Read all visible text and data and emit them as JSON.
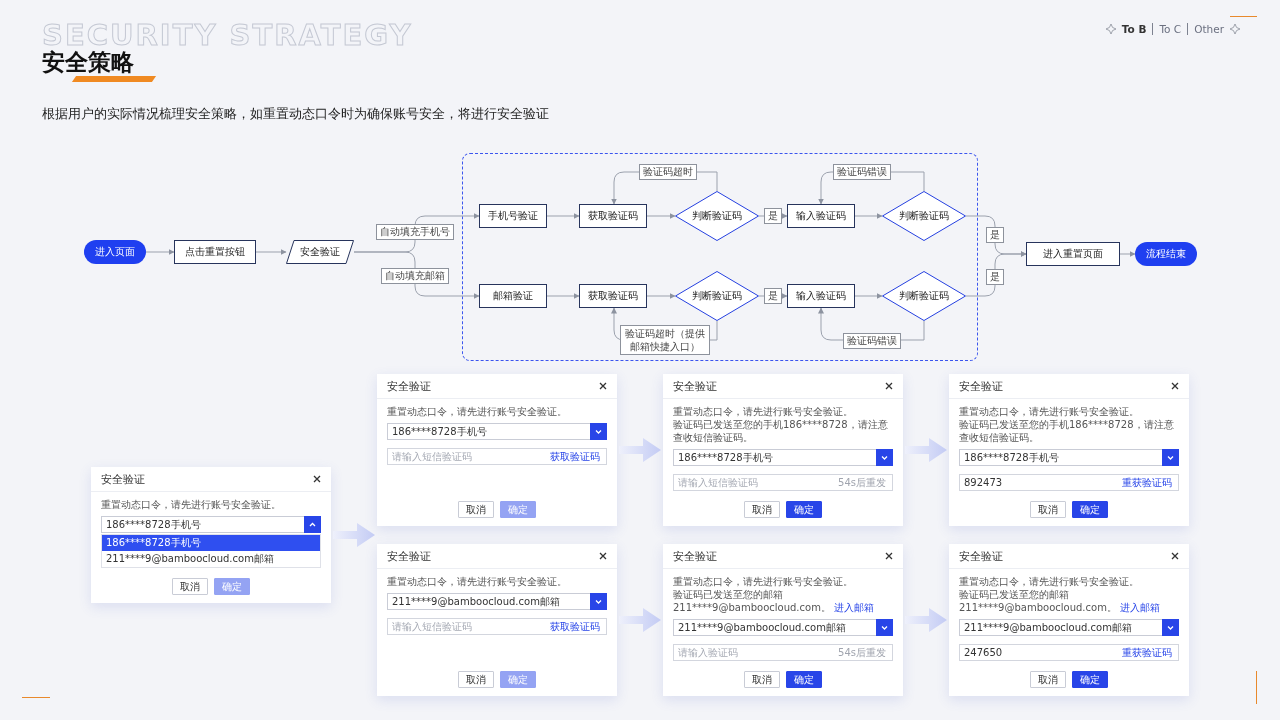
{
  "header": {
    "backdrop_text": "SECURITY STRATEGY",
    "title": "安全策略",
    "description": "根据用户的实际情况梳理安全策略，如重置动态口令时为确保账号安全，将进行安全验证"
  },
  "nav": {
    "tabs": [
      {
        "label": "To B",
        "selected": true
      },
      {
        "label": "To C",
        "selected": false
      },
      {
        "label": "Other",
        "selected": false
      }
    ]
  },
  "flowchart": {
    "nodes": [
      {
        "text": "进入页面",
        "kind": "terminal"
      },
      {
        "text": "点击重置按钮",
        "kind": "process"
      },
      {
        "text": "安全验证",
        "kind": "io"
      },
      {
        "text": "手机号验证",
        "kind": "process"
      },
      {
        "text": "获取验证码",
        "kind": "process"
      },
      {
        "text": "判断验证码",
        "kind": "decision"
      },
      {
        "text": "输入验证码",
        "kind": "process"
      },
      {
        "text": "判断验证码",
        "kind": "decision"
      },
      {
        "text": "邮箱验证",
        "kind": "process"
      },
      {
        "text": "获取验证码",
        "kind": "process"
      },
      {
        "text": "判断验证码",
        "kind": "decision"
      },
      {
        "text": "输入验证码",
        "kind": "process"
      },
      {
        "text": "判断验证码",
        "kind": "decision"
      },
      {
        "text": "进入重置页面",
        "kind": "process"
      },
      {
        "text": "流程结束",
        "kind": "terminal"
      }
    ],
    "edge_labels": [
      {
        "text": "自动填充手机号"
      },
      {
        "text": "自动填充邮箱"
      },
      {
        "text": "验证码超时"
      },
      {
        "text": "是"
      },
      {
        "text": "验证码错误"
      },
      {
        "text": "是"
      },
      {
        "text": "验证码超时（提供邮箱快捷入口）"
      },
      {
        "text": "验证码错误"
      },
      {
        "text": "是"
      },
      {
        "text": "是"
      }
    ]
  },
  "dialogs": [
    {
      "title": "安全验证",
      "lines": [
        {
          "text": "重置动态口令，请先进行账号安全验证。"
        }
      ],
      "select": {
        "value": "186****8728手机号",
        "expanded": true,
        "options": [
          {
            "label": "186****8728手机号",
            "selected": true
          },
          {
            "label": "211****9@bamboocloud.com邮箱",
            "selected": false
          }
        ]
      },
      "buttons": [
        {
          "label": "取消",
          "kind": "secondary",
          "disabled": false
        },
        {
          "label": "确定",
          "kind": "primary",
          "disabled": true
        }
      ]
    },
    {
      "title": "安全验证",
      "lines": [
        {
          "text": "重置动态口令，请先进行账号安全验证。"
        }
      ],
      "select": {
        "value": "186****8728手机号",
        "expanded": false
      },
      "code": {
        "placeholder": "请输入短信验证码",
        "action": "获取验证码",
        "action_disabled": false
      },
      "buttons": [
        {
          "label": "取消",
          "kind": "secondary",
          "disabled": false
        },
        {
          "label": "确定",
          "kind": "primary",
          "disabled": true
        }
      ]
    },
    {
      "title": "安全验证",
      "lines": [
        {
          "text": "重置动态口令，请先进行账号安全验证。"
        },
        {
          "text": "验证码已发送至您的手机186****8728，请注意查收短信验证码。"
        }
      ],
      "select": {
        "value": "186****8728手机号",
        "expanded": false
      },
      "code": {
        "placeholder": "请输入短信验证码",
        "action": "54s后重发",
        "action_disabled": true
      },
      "buttons": [
        {
          "label": "取消",
          "kind": "secondary",
          "disabled": false
        },
        {
          "label": "确定",
          "kind": "primary",
          "disabled": false
        }
      ]
    },
    {
      "title": "安全验证",
      "lines": [
        {
          "text": "重置动态口令，请先进行账号安全验证。"
        },
        {
          "text": "验证码已发送至您的手机186****8728，请注意查收短信验证码。"
        }
      ],
      "select": {
        "value": "186****8728手机号",
        "expanded": false
      },
      "code": {
        "value": "892473",
        "action": "重获验证码",
        "action_disabled": false
      },
      "buttons": [
        {
          "label": "取消",
          "kind": "secondary",
          "disabled": false
        },
        {
          "label": "确定",
          "kind": "primary",
          "disabled": false
        }
      ]
    },
    {
      "title": "安全验证",
      "lines": [
        {
          "text": "重置动态口令，请先进行账号安全验证。"
        }
      ],
      "select": {
        "value": "211****9@bamboocloud.com邮箱",
        "expanded": false
      },
      "code": {
        "placeholder": "请输入短信验证码",
        "action": "获取验证码",
        "action_disabled": false
      },
      "buttons": [
        {
          "label": "取消",
          "kind": "secondary",
          "disabled": false
        },
        {
          "label": "确定",
          "kind": "primary",
          "disabled": true
        }
      ]
    },
    {
      "title": "安全验证",
      "lines": [
        {
          "text": "重置动态口令，请先进行账号安全验证。"
        },
        {
          "text": "验证码已发送至您的邮箱211****9@bamboocloud.com。",
          "link": "进入邮箱"
        }
      ],
      "select": {
        "value": "211****9@bamboocloud.com邮箱",
        "expanded": false
      },
      "code": {
        "placeholder": "请输入验证码",
        "action": "54s后重发",
        "action_disabled": true
      },
      "buttons": [
        {
          "label": "取消",
          "kind": "secondary",
          "disabled": false
        },
        {
          "label": "确定",
          "kind": "primary",
          "disabled": false
        }
      ]
    },
    {
      "title": "安全验证",
      "lines": [
        {
          "text": "重置动态口令，请先进行账号安全验证。"
        },
        {
          "text": "验证码已发送至您的邮箱211****9@bamboocloud.com。",
          "link": "进入邮箱"
        }
      ],
      "select": {
        "value": "211****9@bamboocloud.com邮箱",
        "expanded": false
      },
      "code": {
        "value": "247650",
        "action": "重获验证码",
        "action_disabled": false
      },
      "buttons": [
        {
          "label": "取消",
          "kind": "secondary",
          "disabled": false
        },
        {
          "label": "确定",
          "kind": "primary",
          "disabled": false
        }
      ]
    }
  ]
}
